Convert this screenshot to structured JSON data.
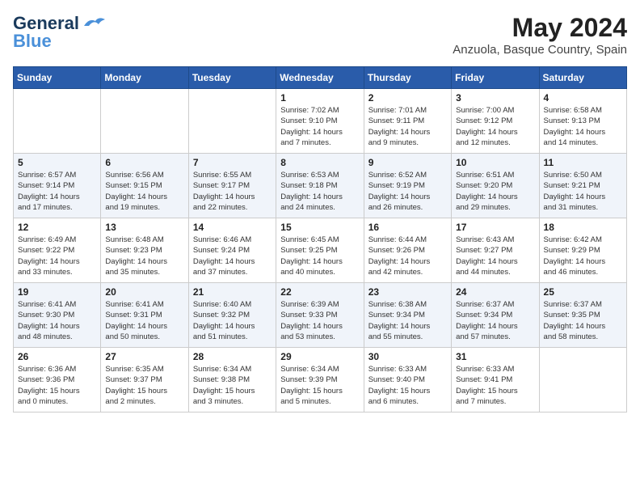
{
  "header": {
    "logo_line1": "General",
    "logo_line2": "Blue",
    "month_year": "May 2024",
    "location": "Anzuola, Basque Country, Spain"
  },
  "weekdays": [
    "Sunday",
    "Monday",
    "Tuesday",
    "Wednesday",
    "Thursday",
    "Friday",
    "Saturday"
  ],
  "weeks": [
    [
      {
        "day": "",
        "info": ""
      },
      {
        "day": "",
        "info": ""
      },
      {
        "day": "",
        "info": ""
      },
      {
        "day": "1",
        "info": "Sunrise: 7:02 AM\nSunset: 9:10 PM\nDaylight: 14 hours\nand 7 minutes."
      },
      {
        "day": "2",
        "info": "Sunrise: 7:01 AM\nSunset: 9:11 PM\nDaylight: 14 hours\nand 9 minutes."
      },
      {
        "day": "3",
        "info": "Sunrise: 7:00 AM\nSunset: 9:12 PM\nDaylight: 14 hours\nand 12 minutes."
      },
      {
        "day": "4",
        "info": "Sunrise: 6:58 AM\nSunset: 9:13 PM\nDaylight: 14 hours\nand 14 minutes."
      }
    ],
    [
      {
        "day": "5",
        "info": "Sunrise: 6:57 AM\nSunset: 9:14 PM\nDaylight: 14 hours\nand 17 minutes."
      },
      {
        "day": "6",
        "info": "Sunrise: 6:56 AM\nSunset: 9:15 PM\nDaylight: 14 hours\nand 19 minutes."
      },
      {
        "day": "7",
        "info": "Sunrise: 6:55 AM\nSunset: 9:17 PM\nDaylight: 14 hours\nand 22 minutes."
      },
      {
        "day": "8",
        "info": "Sunrise: 6:53 AM\nSunset: 9:18 PM\nDaylight: 14 hours\nand 24 minutes."
      },
      {
        "day": "9",
        "info": "Sunrise: 6:52 AM\nSunset: 9:19 PM\nDaylight: 14 hours\nand 26 minutes."
      },
      {
        "day": "10",
        "info": "Sunrise: 6:51 AM\nSunset: 9:20 PM\nDaylight: 14 hours\nand 29 minutes."
      },
      {
        "day": "11",
        "info": "Sunrise: 6:50 AM\nSunset: 9:21 PM\nDaylight: 14 hours\nand 31 minutes."
      }
    ],
    [
      {
        "day": "12",
        "info": "Sunrise: 6:49 AM\nSunset: 9:22 PM\nDaylight: 14 hours\nand 33 minutes."
      },
      {
        "day": "13",
        "info": "Sunrise: 6:48 AM\nSunset: 9:23 PM\nDaylight: 14 hours\nand 35 minutes."
      },
      {
        "day": "14",
        "info": "Sunrise: 6:46 AM\nSunset: 9:24 PM\nDaylight: 14 hours\nand 37 minutes."
      },
      {
        "day": "15",
        "info": "Sunrise: 6:45 AM\nSunset: 9:25 PM\nDaylight: 14 hours\nand 40 minutes."
      },
      {
        "day": "16",
        "info": "Sunrise: 6:44 AM\nSunset: 9:26 PM\nDaylight: 14 hours\nand 42 minutes."
      },
      {
        "day": "17",
        "info": "Sunrise: 6:43 AM\nSunset: 9:27 PM\nDaylight: 14 hours\nand 44 minutes."
      },
      {
        "day": "18",
        "info": "Sunrise: 6:42 AM\nSunset: 9:29 PM\nDaylight: 14 hours\nand 46 minutes."
      }
    ],
    [
      {
        "day": "19",
        "info": "Sunrise: 6:41 AM\nSunset: 9:30 PM\nDaylight: 14 hours\nand 48 minutes."
      },
      {
        "day": "20",
        "info": "Sunrise: 6:41 AM\nSunset: 9:31 PM\nDaylight: 14 hours\nand 50 minutes."
      },
      {
        "day": "21",
        "info": "Sunrise: 6:40 AM\nSunset: 9:32 PM\nDaylight: 14 hours\nand 51 minutes."
      },
      {
        "day": "22",
        "info": "Sunrise: 6:39 AM\nSunset: 9:33 PM\nDaylight: 14 hours\nand 53 minutes."
      },
      {
        "day": "23",
        "info": "Sunrise: 6:38 AM\nSunset: 9:34 PM\nDaylight: 14 hours\nand 55 minutes."
      },
      {
        "day": "24",
        "info": "Sunrise: 6:37 AM\nSunset: 9:34 PM\nDaylight: 14 hours\nand 57 minutes."
      },
      {
        "day": "25",
        "info": "Sunrise: 6:37 AM\nSunset: 9:35 PM\nDaylight: 14 hours\nand 58 minutes."
      }
    ],
    [
      {
        "day": "26",
        "info": "Sunrise: 6:36 AM\nSunset: 9:36 PM\nDaylight: 15 hours\nand 0 minutes."
      },
      {
        "day": "27",
        "info": "Sunrise: 6:35 AM\nSunset: 9:37 PM\nDaylight: 15 hours\nand 2 minutes."
      },
      {
        "day": "28",
        "info": "Sunrise: 6:34 AM\nSunset: 9:38 PM\nDaylight: 15 hours\nand 3 minutes."
      },
      {
        "day": "29",
        "info": "Sunrise: 6:34 AM\nSunset: 9:39 PM\nDaylight: 15 hours\nand 5 minutes."
      },
      {
        "day": "30",
        "info": "Sunrise: 6:33 AM\nSunset: 9:40 PM\nDaylight: 15 hours\nand 6 minutes."
      },
      {
        "day": "31",
        "info": "Sunrise: 6:33 AM\nSunset: 9:41 PM\nDaylight: 15 hours\nand 7 minutes."
      },
      {
        "day": "",
        "info": ""
      }
    ]
  ]
}
